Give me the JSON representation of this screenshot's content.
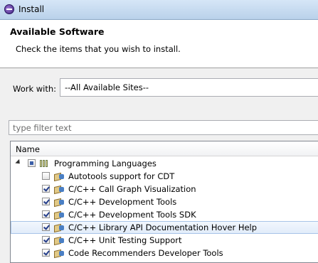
{
  "window": {
    "title": "Install"
  },
  "header": {
    "title": "Available Software",
    "description": "Check the items that you wish to install."
  },
  "work_with": {
    "label": "Work with:",
    "value": "--All Available Sites--"
  },
  "filter": {
    "placeholder": "type filter text"
  },
  "tree": {
    "column_header": "Name",
    "group": {
      "label": "Programming Languages",
      "state": "partial"
    },
    "items": [
      {
        "label": "Autotools support for CDT",
        "checked": false,
        "selected": false
      },
      {
        "label": "C/C++ Call Graph Visualization",
        "checked": true,
        "selected": false
      },
      {
        "label": "C/C++ Development Tools",
        "checked": true,
        "selected": false
      },
      {
        "label": "C/C++ Development Tools SDK",
        "checked": true,
        "selected": false
      },
      {
        "label": "C/C++ Library API Documentation Hover Help",
        "checked": true,
        "selected": true
      },
      {
        "label": "C/C++ Unit Testing Support",
        "checked": true,
        "selected": false
      },
      {
        "label": "Code Recommenders Developer Tools",
        "checked": true,
        "selected": false
      }
    ]
  }
}
